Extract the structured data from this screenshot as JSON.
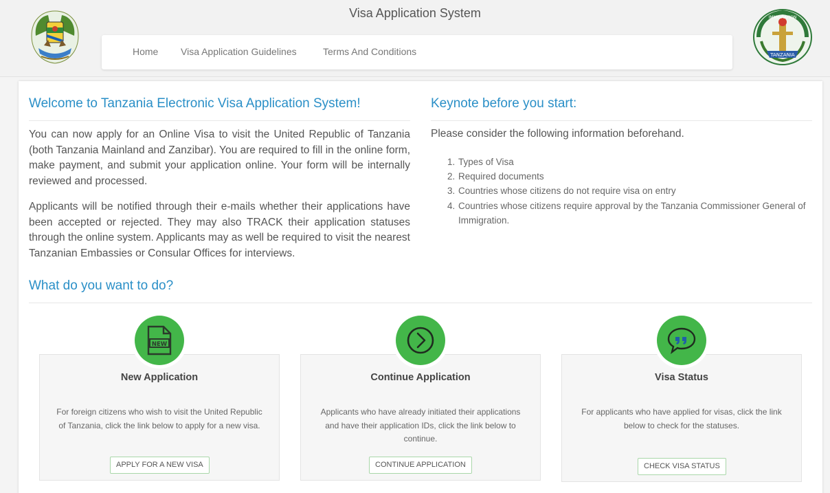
{
  "header": {
    "site_title": "Visa Application System",
    "nav": [
      {
        "label": "Home"
      },
      {
        "label": "Visa Application Guidelines"
      },
      {
        "label": "Terms And Conditions"
      }
    ],
    "left_logo": "coat-of-arms-icon",
    "right_logo": {
      "icon": "immigration-emblem-icon",
      "label": "IMMIGRATION",
      "sublabel": "TANZANIA"
    }
  },
  "welcome": {
    "title": "Welcome to Tanzania Electronic Visa Application System!",
    "para1": "You can now apply for an Online Visa to visit the United Republic of Tanzania (both Tanzania Mainland and Zanzibar). You are required to fill in the online form, make payment, and submit your application online. Your form will be internally reviewed and processed.",
    "para2": "Applicants will be notified through their e-mails whether their applications have been accepted or rejected. They may also TRACK their application statuses through the online system. Applicants may as well be required to visit the nearest Tanzanian Embassies or Consular Offices for interviews."
  },
  "keynote": {
    "title": "Keynote before you start:",
    "lead": "Please consider the following information beforehand.",
    "items": [
      {
        "num": "1.",
        "text": "Types of Visa"
      },
      {
        "num": "2.",
        "text": "Required documents"
      },
      {
        "num": "3.",
        "text": "Countries whose citizens do not require visa on entry"
      },
      {
        "num": "4.",
        "text": "Countries whose citizens require approval by the Tanzania Commissioner General of Immigration."
      }
    ]
  },
  "actions": {
    "title": "What do you want to do?",
    "cards": [
      {
        "icon": "new-document-icon",
        "title": "New Application",
        "desc": "For foreign citizens who wish to visit the United Republic of Tanzania, click the link below to apply for a new visa.",
        "button": "APPLY FOR A NEW VISA"
      },
      {
        "icon": "arrow-right-circle-icon",
        "title": "Continue Application",
        "desc": "Applicants who have already initiated their applications and have their application IDs, click the link below to continue.",
        "button": "CONTINUE APPLICATION"
      },
      {
        "icon": "quote-bubble-icon",
        "title": "Visa Status",
        "desc": "For applicants who have applied for visas, click the link below to check for the statuses.",
        "button": "CHECK VISA STATUS"
      }
    ]
  },
  "colors": {
    "accent": "#2a8fc7",
    "icon_green": "#43b649"
  }
}
